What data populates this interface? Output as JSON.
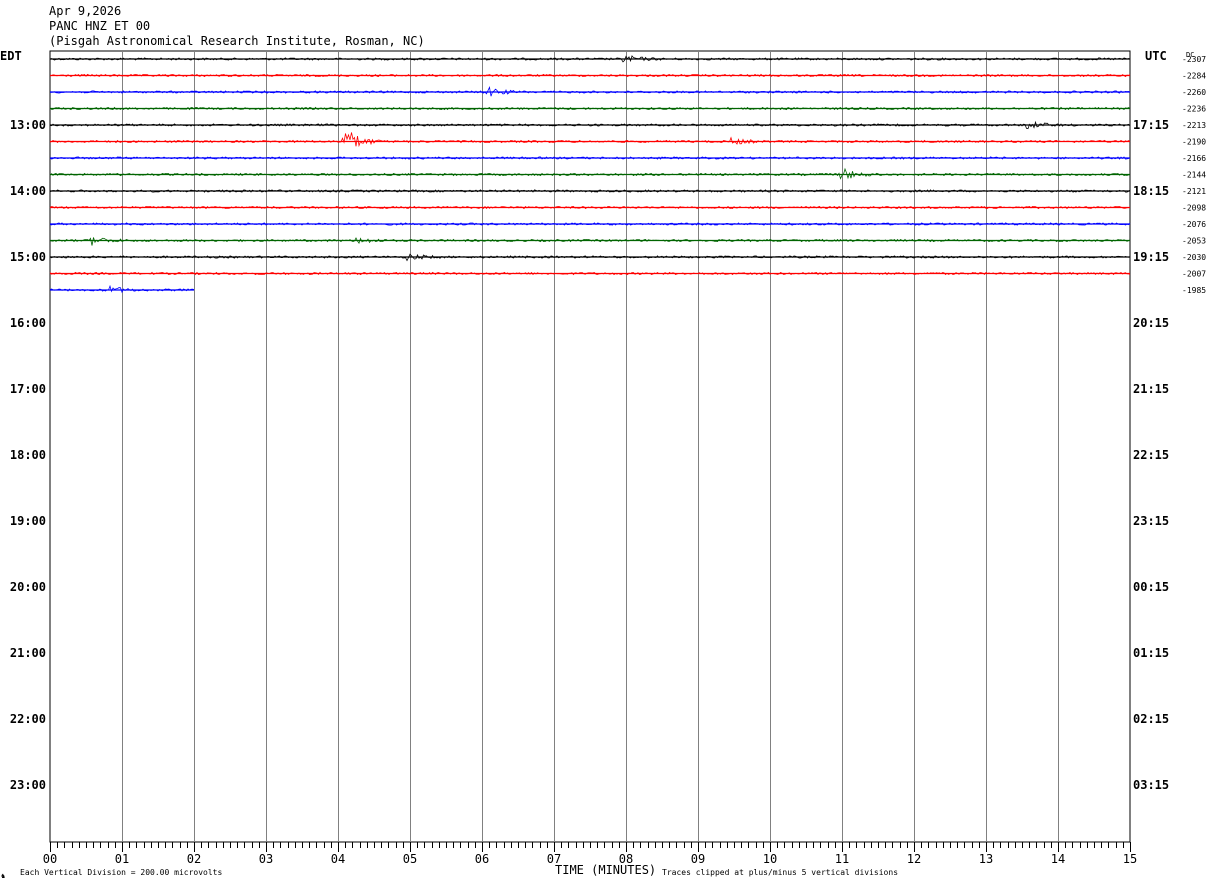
{
  "header": {
    "date": "Apr 9,2026",
    "station": "PANC HNZ ET 00",
    "location": "(Pisgah Astronomical Research Institute, Rosman, NC)"
  },
  "labels": {
    "left_tz": "EDT",
    "right_tz": "UTC",
    "dc": "DC",
    "xlabel": "TIME (MINUTES)",
    "footer_left": "Each Vertical Division =  200.00 microvolts",
    "footer_right": "Traces clipped at plus/minus 5 vertical divisions",
    "corner_mark": "♞"
  },
  "chart_data": {
    "type": "line",
    "title": "PANC HNZ ET 00",
    "xlabel": "TIME (MINUTES)",
    "xlim": [
      0,
      15
    ],
    "x_ticks": [
      "00",
      "01",
      "02",
      "03",
      "04",
      "05",
      "06",
      "07",
      "08",
      "09",
      "10",
      "11",
      "12",
      "13",
      "14",
      "15"
    ],
    "grid": true,
    "left_hour_labels": [
      "13:00",
      "14:00",
      "15:00",
      "16:00",
      "17:00",
      "18:00",
      "19:00",
      "20:00",
      "21:00",
      "22:00",
      "23:00"
    ],
    "right_hour_labels": [
      "17:15",
      "18:15",
      "19:15",
      "20:15",
      "21:15",
      "22:15",
      "23:15",
      "00:15",
      "01:15",
      "02:15",
      "03:15"
    ],
    "trace_colors": [
      "#000000",
      "#ff0000",
      "#0000ff",
      "#006400"
    ],
    "traces": [
      {
        "dc": "2307",
        "end_minute": 15,
        "events": [
          {
            "minute": 8.0,
            "amp": 0.25
          }
        ]
      },
      {
        "dc": "2284",
        "end_minute": 15,
        "events": []
      },
      {
        "dc": "2260",
        "end_minute": 15,
        "events": [
          {
            "minute": 6.1,
            "amp": 0.3
          }
        ]
      },
      {
        "dc": "2236",
        "end_minute": 15,
        "events": []
      },
      {
        "dc": "2213",
        "end_minute": 15,
        "events": [
          {
            "minute": 13.6,
            "amp": 0.25
          }
        ]
      },
      {
        "dc": "2190",
        "end_minute": 15,
        "events": [
          {
            "minute": 4.1,
            "amp": 1.0
          },
          {
            "minute": 9.5,
            "amp": 0.2
          }
        ]
      },
      {
        "dc": "2166",
        "end_minute": 15,
        "events": []
      },
      {
        "dc": "2144",
        "end_minute": 15,
        "events": [
          {
            "minute": 11.0,
            "amp": 0.45
          }
        ]
      },
      {
        "dc": "2121",
        "end_minute": 15,
        "events": []
      },
      {
        "dc": "2098",
        "end_minute": 15,
        "events": []
      },
      {
        "dc": "2076",
        "end_minute": 15,
        "events": []
      },
      {
        "dc": "2053",
        "end_minute": 15,
        "events": [
          {
            "minute": 0.6,
            "amp": 0.3
          },
          {
            "minute": 4.3,
            "amp": 0.2
          }
        ]
      },
      {
        "dc": "2030",
        "end_minute": 15,
        "events": [
          {
            "minute": 5.0,
            "amp": 0.2
          }
        ]
      },
      {
        "dc": "2007",
        "end_minute": 15,
        "events": []
      },
      {
        "dc": "1985",
        "end_minute": 2,
        "events": [
          {
            "minute": 0.8,
            "amp": 0.3
          }
        ]
      }
    ]
  }
}
